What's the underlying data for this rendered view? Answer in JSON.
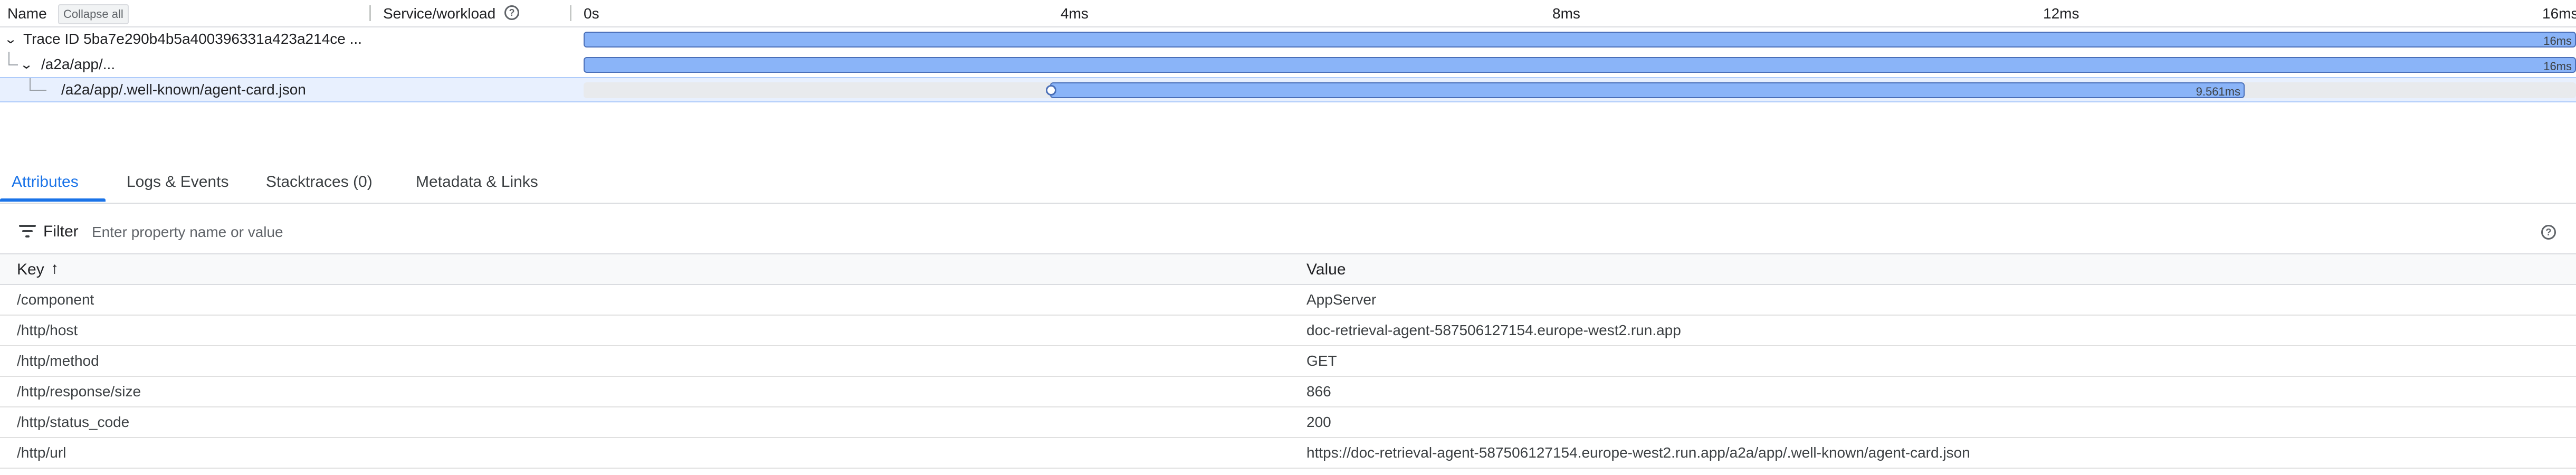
{
  "waterfall": {
    "header": {
      "name_label": "Name",
      "collapse_all": "Collapse all",
      "service_label": "Service/workload",
      "ticks": [
        "0s",
        "4ms",
        "8ms",
        "12ms",
        "16ms"
      ]
    },
    "rows": [
      {
        "label": "Trace ID 5ba7e290b4b5a400396331a423a214ce ...",
        "duration": "16ms"
      },
      {
        "label": "/a2a/app/...",
        "duration": "16ms"
      },
      {
        "label": "/a2a/app/.well-known/agent-card.json",
        "duration": "9.561ms"
      }
    ]
  },
  "tabs": [
    {
      "label": "Attributes",
      "active": true
    },
    {
      "label": "Logs & Events"
    },
    {
      "label": "Stacktraces (0)"
    },
    {
      "label": "Metadata & Links"
    }
  ],
  "filter": {
    "label": "Filter",
    "placeholder": "Enter property name or value"
  },
  "table": {
    "key_header": "Key",
    "value_header": "Value",
    "rows": [
      {
        "key": "/component",
        "value": "AppServer"
      },
      {
        "key": "/http/host",
        "value": "doc-retrieval-agent-587506127154.europe-west2.run.app"
      },
      {
        "key": "/http/method",
        "value": "GET"
      },
      {
        "key": "/http/response/size",
        "value": "866"
      },
      {
        "key": "/http/status_code",
        "value": "200"
      },
      {
        "key": "/http/url",
        "value": "https://doc-retrieval-agent-587506127154.europe-west2.run.app/a2a/app/.well-known/agent-card.json"
      }
    ]
  },
  "colors": {
    "accent": "#1a73e8",
    "span_bar": "#8ab4f8",
    "selected_row": "#e8f0fe"
  }
}
